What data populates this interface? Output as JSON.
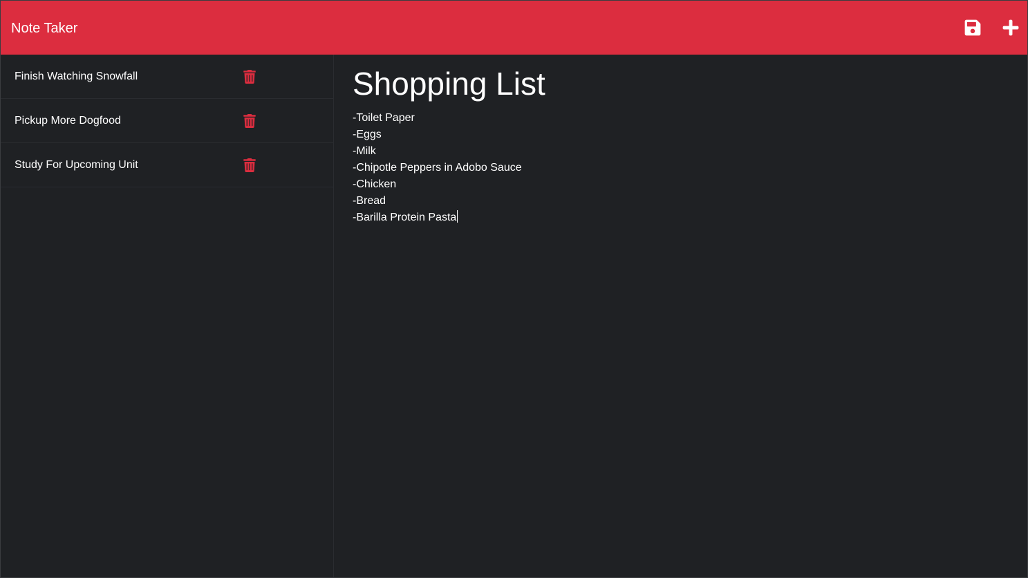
{
  "app": {
    "title": "Note Taker",
    "accent_color": "#dc2d3f",
    "background_color": "#1f2124"
  },
  "toolbar": {
    "save_icon": "floppy-disk-save-icon",
    "add_icon": "plus-new-note-icon"
  },
  "notes": [
    {
      "title": "Finish Watching Snowfall",
      "delete_icon": "trash-icon"
    },
    {
      "title": "Pickup More Dogfood",
      "delete_icon": "trash-icon"
    },
    {
      "title": "Study For Upcoming Unit",
      "delete_icon": "trash-icon"
    }
  ],
  "active_note": {
    "title": "Shopping List",
    "lines": [
      "-Toilet Paper",
      "-Eggs",
      "-Milk",
      "-Chipotle Peppers in Adobo Sauce",
      "-Chicken",
      "-Bread",
      "-Barilla Protein Pasta"
    ]
  }
}
